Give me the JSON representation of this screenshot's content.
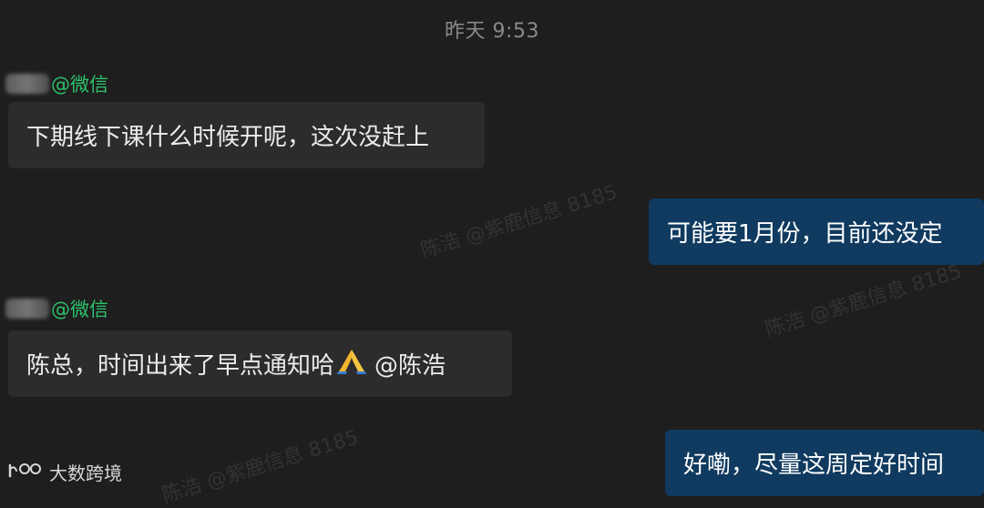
{
  "chat": {
    "timestamp": "昨天 9:53",
    "messages": [
      {
        "direction": "in",
        "sender_tag": "@微信",
        "text": "下期线下课什么时候开呢，这次没赶上"
      },
      {
        "direction": "out",
        "text": "可能要1月份，目前还没定"
      },
      {
        "direction": "in",
        "sender_tag": "@微信",
        "text": "陈总，时间出来了早点通知哈",
        "emoji": "praying-hands-icon",
        "mention": "@陈浩"
      },
      {
        "direction": "out",
        "text": "好嘞，尽量这周定好时间"
      }
    ]
  },
  "watermark": {
    "text": "陈浩 @紫鹿信息 8185"
  },
  "brand": {
    "icon": "dashuju-logo-icon",
    "label": "大数跨境"
  },
  "colors": {
    "background": "#1e1e1e",
    "incoming_bubble": "#2c2c2c",
    "outgoing_bubble": "#103a5f",
    "sender_tag": "#2dc26b",
    "timestamp": "#8a8a8a"
  }
}
